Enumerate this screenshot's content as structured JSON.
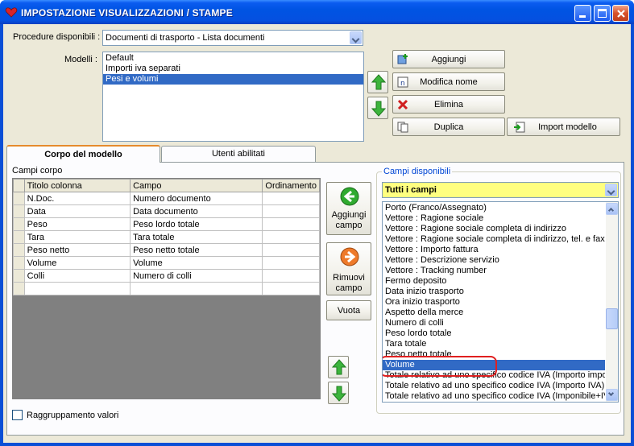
{
  "window": {
    "title": "IMPOSTAZIONE VISUALIZZAZIONI / STAMPE"
  },
  "procedure": {
    "label": "Procedure disponibili :",
    "value": "Documenti di trasporto - Lista documenti"
  },
  "modelli": {
    "label": "Modelli :",
    "items": [
      "Default",
      "Importi iva separati",
      "Pesi e volumi"
    ],
    "selected_index": 2
  },
  "buttons": {
    "aggiungi": "Aggiungi",
    "modifica_nome": "Modifica nome",
    "elimina": "Elimina",
    "duplica": "Duplica",
    "import_modello": "Import modello",
    "aggiungi_campo_1": "Aggiungi",
    "aggiungi_campo_2": "campo",
    "rimuovi_campo_1": "Rimuovi",
    "rimuovi_campo_2": "campo",
    "vuota": "Vuota"
  },
  "tabs": [
    {
      "label": "Corpo del modello",
      "active": true
    },
    {
      "label": "Utenti abilitati",
      "active": false
    }
  ],
  "campi_corpo": {
    "label": "Campi corpo",
    "columns": [
      "Titolo colonna",
      "Campo",
      "Ordinamento"
    ],
    "rows": [
      [
        "N.Doc.",
        "Numero documento",
        ""
      ],
      [
        "Data",
        "Data documento",
        ""
      ],
      [
        "Peso",
        "Peso lordo totale",
        ""
      ],
      [
        "Tara",
        "Tara totale",
        ""
      ],
      [
        "Peso netto",
        "Peso netto totale",
        ""
      ],
      [
        "Volume",
        "Volume",
        ""
      ],
      [
        "Colli",
        "Numero di colli",
        ""
      ],
      [
        "",
        "",
        ""
      ]
    ]
  },
  "campi_disponibili": {
    "legend": "Campi disponibili",
    "filter_value": "Tutti i campi",
    "items": [
      "Porto (Franco/Assegnato)",
      "Vettore : Ragione sociale",
      "Vettore : Ragione sociale completa di indirizzo",
      "Vettore : Ragione sociale completa di indirizzo, tel. e fax",
      "Vettore : Importo fattura",
      "Vettore : Descrizione servizio",
      "Vettore : Tracking number",
      "Fermo deposito",
      "Data inizio trasporto",
      "Ora inizio trasporto",
      "Aspetto della merce",
      "Numero di colli",
      "Peso lordo totale",
      "Tara totale",
      "Peso netto totale",
      "Volume",
      "Totale relativo ad uno specifico codice IVA (Importo imponibile)",
      "Totale relativo ad uno specifico codice IVA (Importo IVA)",
      "Totale relativo ad uno specifico codice IVA (Imponibile+IVA)"
    ],
    "selected_index": 15
  },
  "raggruppamento": {
    "label": "Raggruppamento valori",
    "checked": false
  },
  "colors": {
    "selection": "#316ac5",
    "highlight_ring": "#e02020",
    "filter_bg": "#ffff80",
    "title_bar": "#0054e3"
  }
}
